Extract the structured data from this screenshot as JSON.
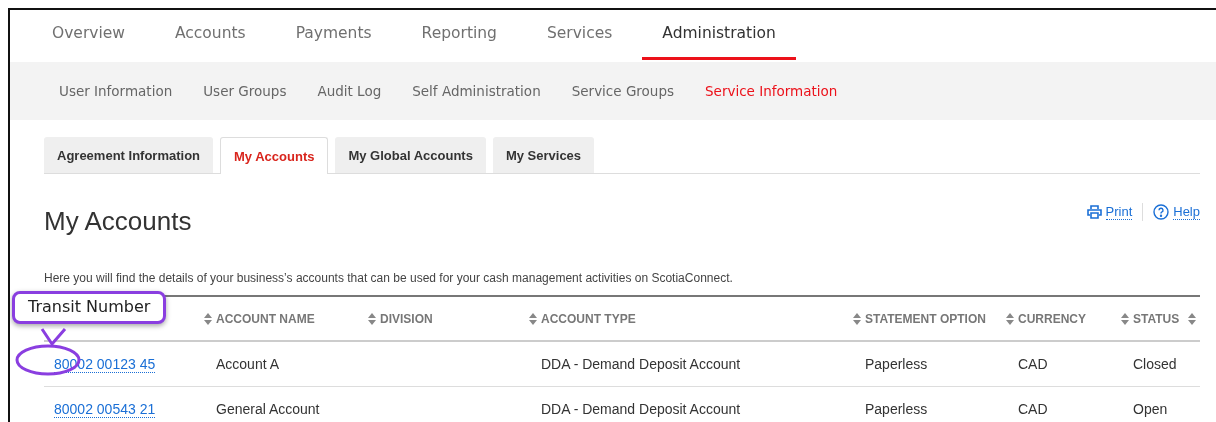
{
  "main_nav": [
    {
      "label": "Overview",
      "selected": false
    },
    {
      "label": "Accounts",
      "selected": false
    },
    {
      "label": "Payments",
      "selected": false
    },
    {
      "label": "Reporting",
      "selected": false
    },
    {
      "label": "Services",
      "selected": false
    },
    {
      "label": "Administration",
      "selected": true
    }
  ],
  "sub_nav": [
    {
      "label": "User Information",
      "selected": false
    },
    {
      "label": "User Groups",
      "selected": false
    },
    {
      "label": "Audit Log",
      "selected": false
    },
    {
      "label": "Self Administration",
      "selected": false
    },
    {
      "label": "Service Groups",
      "selected": false
    },
    {
      "label": "Service Information",
      "selected": true
    }
  ],
  "tabs": [
    {
      "label": "Agreement Information",
      "selected": false
    },
    {
      "label": "My Accounts",
      "selected": true
    },
    {
      "label": "My Global Accounts",
      "selected": false
    },
    {
      "label": "My Services",
      "selected": false
    }
  ],
  "page_title": "My Accounts",
  "actions": {
    "print": "Print",
    "help": "Help"
  },
  "description": "Here you will find the details of your business’s accounts that can be used for your cash management activities on ScotiaConnect.",
  "table": {
    "columns": [
      "ACCOUNT NAME",
      "DIVISION",
      "ACCOUNT TYPE",
      "STATEMENT OPTION",
      "CURRENCY",
      "STATUS"
    ],
    "rows": [
      {
        "account_number": "80002 00123 45",
        "cells": [
          "Account A",
          "",
          "DDA - Demand Deposit Account",
          "Paperless",
          "CAD",
          "Closed"
        ]
      },
      {
        "account_number": "80002 00543 21",
        "cells": [
          "General Account",
          "",
          "DDA - Demand Deposit Account",
          "Paperless",
          "CAD",
          "Open"
        ]
      }
    ]
  },
  "callout": {
    "label": "Transit Number"
  }
}
